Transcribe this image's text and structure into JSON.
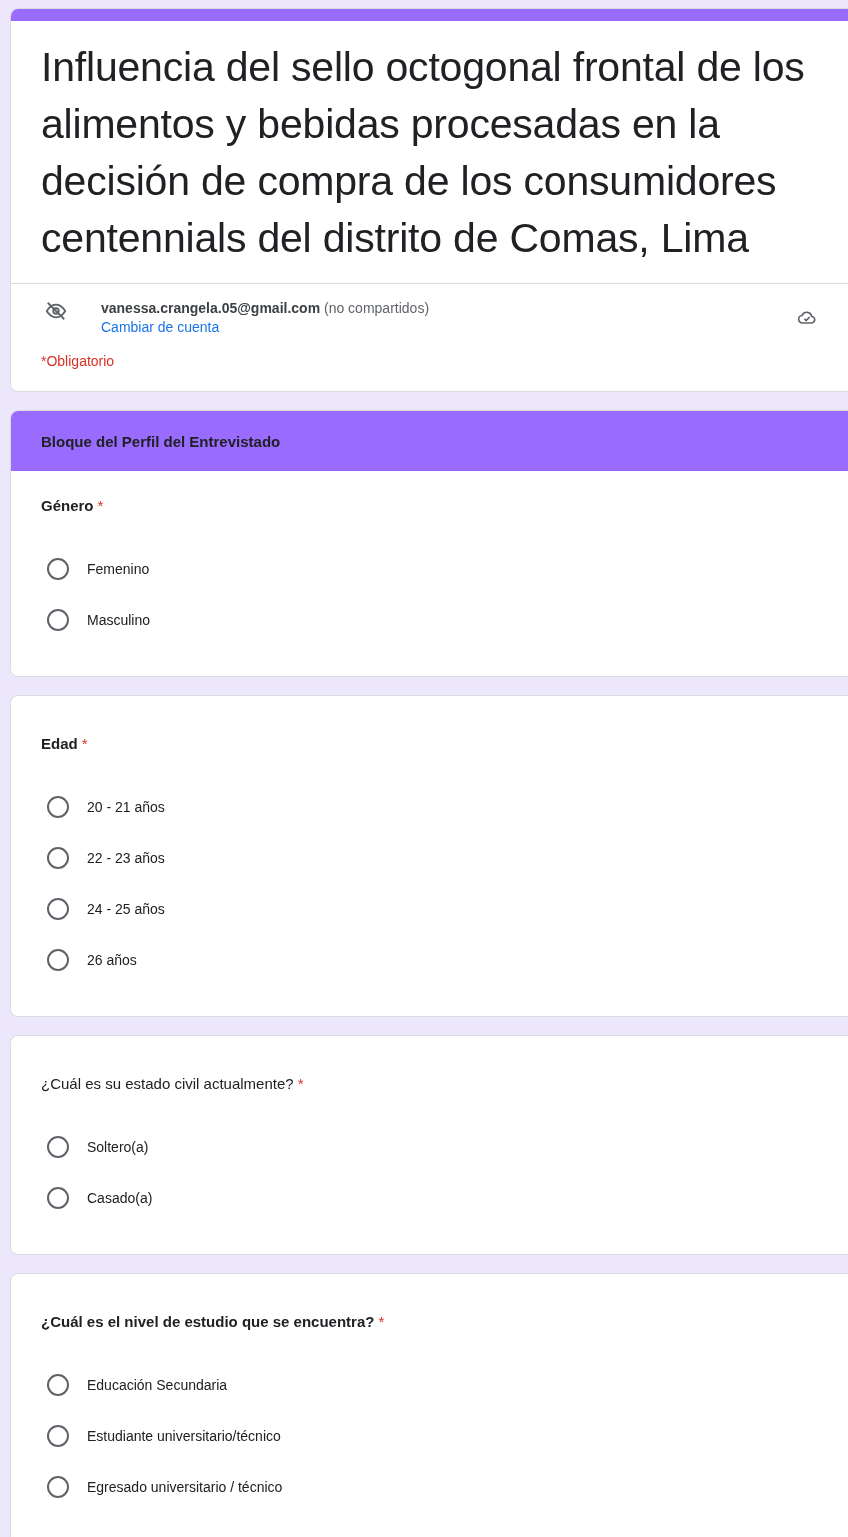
{
  "form": {
    "title": "Influencia del sello octogonal frontal de los alimentos y bebidas procesadas en la decisión de compra de los consumidores centennials del distrito de Comas, Lima",
    "account": {
      "email": "vanessa.crangela.05@gmail.com",
      "note": "(no compartidos)",
      "switch_link": "Cambiar de cuenta"
    },
    "required_notice": "*Obligatorio"
  },
  "section": {
    "title": "Bloque del Perfil del Entrevistado"
  },
  "questions": [
    {
      "title": "Género",
      "bold": true,
      "required_mark": "*",
      "options": [
        {
          "label": "Femenino",
          "selected": false
        },
        {
          "label": "Masculino",
          "selected": false
        }
      ]
    },
    {
      "title": "Edad",
      "bold": true,
      "required_mark": "*",
      "options": [
        {
          "label": "20 - 21 años",
          "selected": false
        },
        {
          "label": "22 - 23 años",
          "selected": false
        },
        {
          "label": "24 - 25 años",
          "selected": false
        },
        {
          "label": "26 años",
          "selected": false
        }
      ]
    },
    {
      "title": "¿Cuál es su estado civil actualmente?",
      "bold": false,
      "required_mark": "*",
      "options": [
        {
          "label": "Soltero(a)",
          "selected": false
        },
        {
          "label": "Casado(a)",
          "selected": false
        }
      ]
    },
    {
      "title": "¿Cuál es el nivel de estudio que se encuentra?",
      "bold": true,
      "required_mark": "*",
      "options": [
        {
          "label": "Educación Secundaria",
          "selected": false
        },
        {
          "label": "Estudiante universitario/técnico",
          "selected": false
        },
        {
          "label": "Egresado universitario / técnico",
          "selected": false
        }
      ]
    }
  ]
}
